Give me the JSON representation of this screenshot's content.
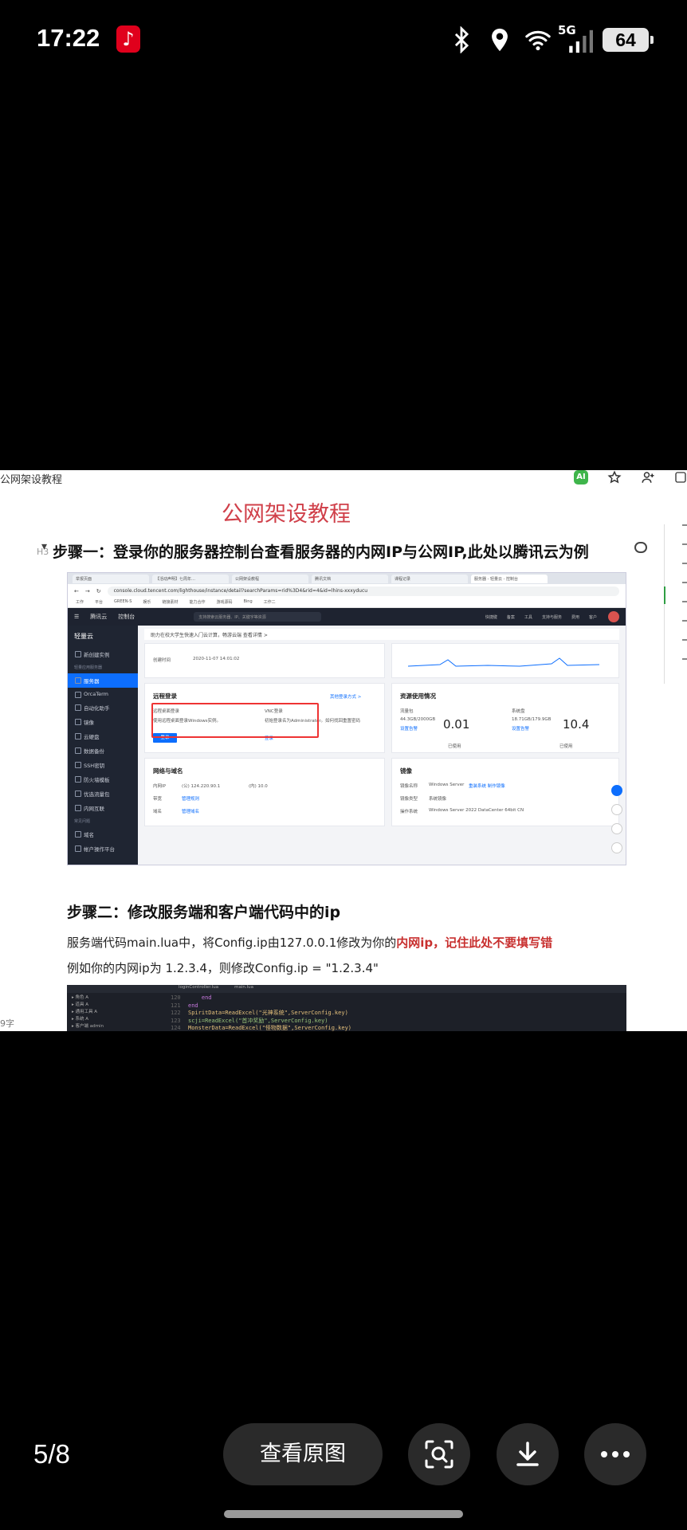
{
  "status_bar": {
    "time": "17:22",
    "network": "5G",
    "battery": "64"
  },
  "document": {
    "filename": "公网架设教程",
    "ai_badge": "AI",
    "title": "公网架设教程",
    "heading_tag": "H3",
    "step1": "步骤一：登录你的服务器控制台查看服务器的内网IP与公网IP,此处以腾讯云为例",
    "step2": "步骤二：修改服务端和客户端代码中的ip",
    "para1_prefix": "服务端代码main.lua中，将Config.ip由127.0.0.1修改为你的",
    "para1_highlight": "内网ip，记住此处不要填写错",
    "para2": "例如你的内网ip为 1.2.3.4，则修改Config.ip = \"1.2.3.4\"",
    "word_count": "9字"
  },
  "screenshot": {
    "tabs": [
      "举报页面",
      "【活动声明】七周年…",
      "公网架设教程",
      "腾讯文档",
      "课程记录",
      "服务器 - 轻量云 - 控制台"
    ],
    "url": "console.cloud.tencent.com/lighthouse/instance/detail?searchParams=rid%3D4&rid=4&id=lhins-xxxyducu",
    "bookmarks": [
      "工作",
      "平台",
      "GREEN-S",
      "娱乐",
      "链接素材",
      "能力合作",
      "游戏源码",
      "Bing",
      "工作二"
    ],
    "console_brand": "腾讯云",
    "console_home": "控制台",
    "console_search": "支持搜索云服务器、IP、关键字等资源",
    "console_links": [
      "快捷键",
      "备案",
      "工具",
      "支持与服务",
      "费用",
      "客户"
    ],
    "nav_title": "轻量云",
    "nav_items": [
      "新创建实例",
      "服务器",
      "OrcaTerm",
      "自动化助手",
      "镜像",
      "云硬盘",
      "数据备份",
      "SSH密钥",
      "防火墙模板",
      "优选流量包",
      "内网互联",
      "域名",
      "帐户操作平台"
    ],
    "nav_groups": [
      "轻量应用服务器",
      "常见问题"
    ],
    "notice": "助力在校大学生快速入门云计算，畅游云端  查看详情 >",
    "created_label": "创建时间",
    "created_value": "2020-11-07 14:01:02",
    "remote_title": "远程登录",
    "remote_more": "其他登录方式 >",
    "remote_std": "远程桌面登录",
    "remote_std_desc": "使用远程桌面登录Windows实例。",
    "vnc_label": "VNC登录",
    "vnc_desc": "初始登录名为Administrator。如何找回重置密码",
    "login_btn": "登录",
    "login_link": "登录",
    "resource_title": "资源使用情况",
    "traffic_label": "流量包",
    "traffic_value": "44.3GB/2000GB",
    "traffic_num": "0.01",
    "traffic_link": "设置告警",
    "traffic_used": "已使用",
    "disk_label": "系统盘",
    "disk_value": "18.71GB/179.9GB",
    "disk_num": "10.4",
    "disk_link": "设置告警",
    "disk_used": "已使用",
    "network_title": "网络与域名",
    "ip_label": "内网IP",
    "ip_public": "(公) 124.220.90.1",
    "ip_private": "(内) 10.0",
    "bandwidth_label": "带宽",
    "bandwidth_link": "管理规则",
    "domain_label": "域名",
    "domain_link": "管理域名",
    "image_title": "镜像",
    "image_name_label": "镜像名称",
    "image_name": "Windows Server",
    "image_reinstall": "重装系统  制作镜像",
    "image_type_label": "镜像类型",
    "image_type": "系统镜像",
    "os_label": "操作系统",
    "os_value": "Windows Server 2022 DataCenter 64bit CN"
  },
  "code": {
    "tabs": [
      "loginController.lua",
      "main.lua"
    ],
    "tree": [
      "▸ 角色 A",
      "▸ 道具 A",
      "▸ 通用工具 A",
      "▸ 系统 A",
      "▸ 客户端 admin"
    ],
    "lines": [
      {
        "n": "120",
        "t": "    end"
      },
      {
        "n": "121",
        "t": "end"
      },
      {
        "n": "122",
        "t": "SpiritData=ReadExcel(\"光神系统\",ServerConfig.key)"
      },
      {
        "n": "123",
        "t": "scji=ReadExcel(\"首冲奖励\",ServerConfig.key)"
      },
      {
        "n": "124",
        "t": "MonsterData=ReadExcel(\"怪物数据\",ServerConfig.key)"
      }
    ]
  },
  "bottom_bar": {
    "page_counter": "5/8",
    "view_original": "查看原图"
  }
}
